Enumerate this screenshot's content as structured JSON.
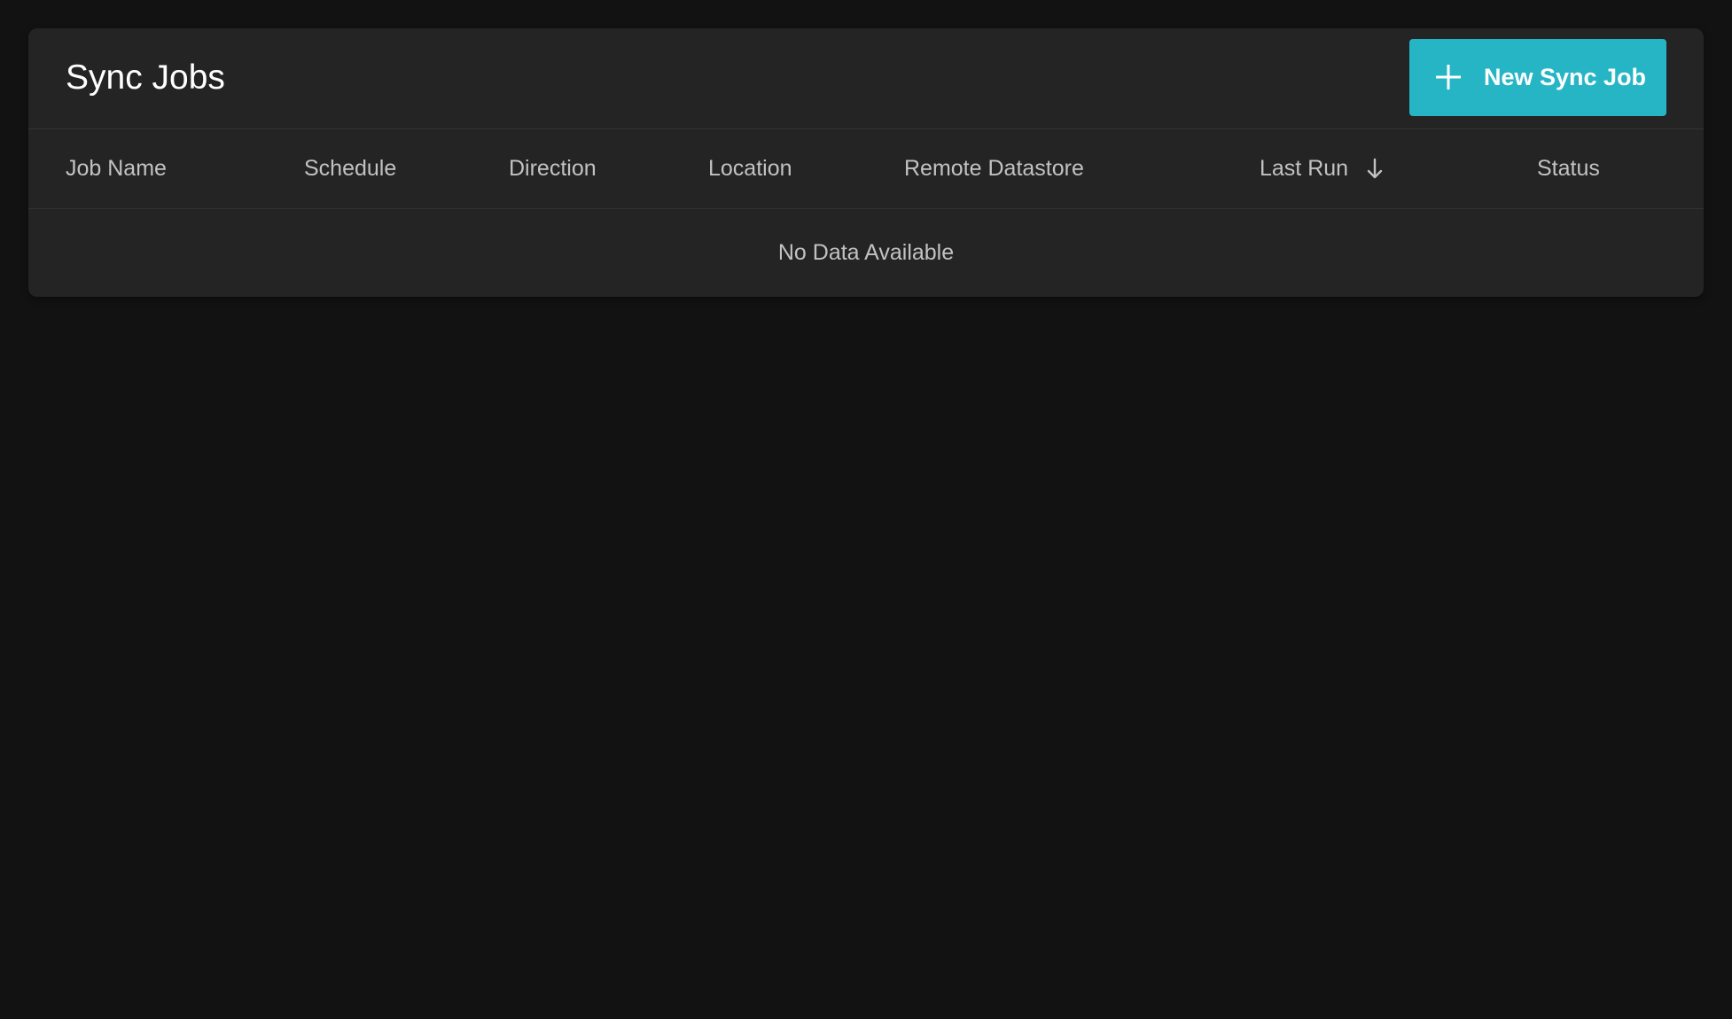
{
  "page": {
    "title": "Sync Jobs"
  },
  "toolbar": {
    "new_label": "New Sync Job",
    "new_icon": "plus-icon"
  },
  "table": {
    "columns": [
      {
        "key": "job_name",
        "label": "Job Name"
      },
      {
        "key": "schedule",
        "label": "Schedule"
      },
      {
        "key": "direction",
        "label": "Direction"
      },
      {
        "key": "location",
        "label": "Location"
      },
      {
        "key": "remote_datastore",
        "label": "Remote Datastore"
      },
      {
        "key": "last_run",
        "label": "Last Run",
        "sort": "descending",
        "sort_icon": "arrow-down-icon"
      },
      {
        "key": "status",
        "label": "Status"
      }
    ],
    "rows": [],
    "empty_text": "No Data Available"
  },
  "colors": {
    "background": "#121212",
    "card": "#242424",
    "accent": "#26b5c5",
    "header_text": "#c2c2c2"
  }
}
